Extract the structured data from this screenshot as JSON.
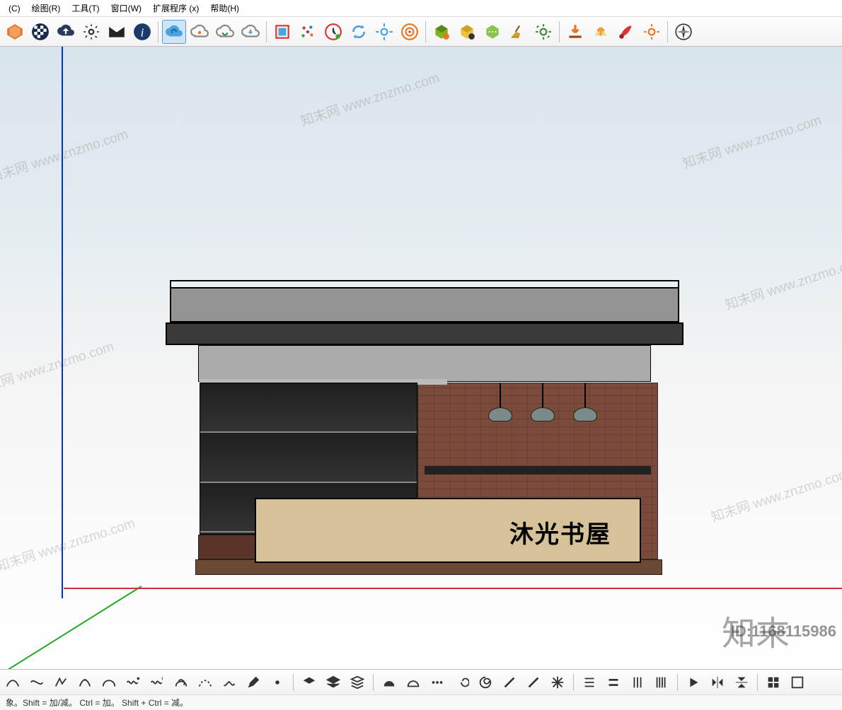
{
  "menu": {
    "items": [
      {
        "label": "(C)",
        "key": "camera"
      },
      {
        "label": "绘图(R)",
        "key": "draw"
      },
      {
        "label": "工具(T)",
        "key": "tools"
      },
      {
        "label": "窗口(W)",
        "key": "window"
      },
      {
        "label": "扩展程序 (x)",
        "key": "extensions"
      },
      {
        "label": "帮助(H)",
        "key": "help"
      }
    ]
  },
  "toolbar_top": {
    "groups": [
      {
        "icons": [
          "sketchup-logo",
          "checker",
          "cloud-up",
          "gear",
          "envelope",
          "info"
        ]
      },
      {
        "icons": [
          "cloud-sync",
          "cloud-link",
          "cloud-refresh",
          "cloud-dl"
        ]
      },
      {
        "icons": [
          "crop",
          "scatter",
          "clock",
          "sync",
          "gear2",
          "target"
        ]
      },
      {
        "icons": [
          "box-green",
          "box-yellow",
          "box-dots",
          "broom",
          "gear3"
        ]
      },
      {
        "icons": [
          "down-orange",
          "up-orange",
          "paint",
          "gear4"
        ]
      },
      {
        "icons": [
          "compass"
        ]
      }
    ],
    "active_index": 6
  },
  "model": {
    "sign_text": "沐光书屋"
  },
  "watermarks": {
    "text": "知末网 www.znzmo.com",
    "brand": "知末",
    "id_label": "ID:1168115986"
  },
  "bottom_toolbar": {
    "icons": [
      "wavy1",
      "wavy2",
      "arc1",
      "arc2",
      "arc3",
      "squiggle",
      "zig",
      "loop",
      "dash",
      "path",
      "pen",
      "dot",
      "layer1",
      "layer2",
      "layer3",
      "triA",
      "triB",
      "dots",
      "swirl",
      "swirl2",
      "stroke",
      "slash",
      "burst",
      "para1",
      "para2",
      "para3",
      "bars",
      "sep",
      "tri-r",
      "mirror",
      "flip",
      "grid",
      "box"
    ]
  },
  "status": {
    "text": "象。Shift = 加/减。 Ctrl = 加。 Shift + Ctrl = 减。"
  }
}
